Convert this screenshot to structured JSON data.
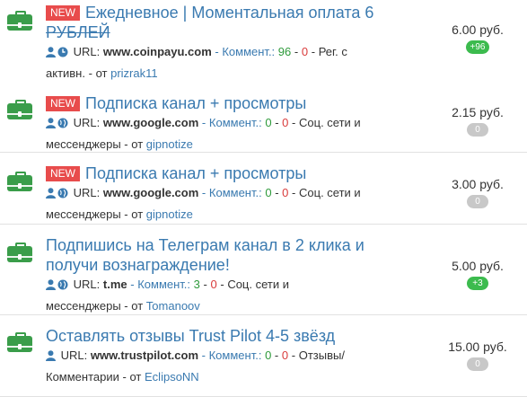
{
  "colors": {
    "accent": "#3a7ab0",
    "badge": "#e84c4c",
    "positive": "#2e9a3b",
    "negative": "#d93b3b",
    "case": "#3a9d4a",
    "pill_green": "#3cbb4e",
    "pill_gray": "#c8c8c8"
  },
  "labels": {
    "url": "URL:",
    "comments": "Коммент.:",
    "dash": "-",
    "from": "от"
  },
  "tasks": [
    {
      "badge": "NEW",
      "title_line1": "Ежедневное | Моментальная оплата 6",
      "title_line2": "РУБЛЕЙ",
      "url": "www.coinpayu.com",
      "comments_pos": "96",
      "comments_neg": "0",
      "category_line1": "Рег. с",
      "category_line2": "активн.",
      "author": "prizrak11",
      "price": "6.00 руб.",
      "rating": "+96",
      "rating_color": "green",
      "icons": [
        "user-icon",
        "clock-icon"
      ]
    },
    {
      "badge": "NEW",
      "title_line1": "Подписка канал + просмотры",
      "url": "www.google.com",
      "comments_pos": "0",
      "comments_neg": "0",
      "category_line1": "Соц. сети и",
      "category_line2": "мессенджеры",
      "author": "gipnotize",
      "price": "2.15 руб.",
      "rating": "0",
      "rating_color": "gray",
      "icons": [
        "user-icon",
        "globe-icon"
      ]
    },
    {
      "badge": "NEW",
      "title_line1": "Подписка канал + просмотры",
      "url": "www.google.com",
      "comments_pos": "0",
      "comments_neg": "0",
      "category_line1": "Соц. сети и",
      "category_line2": "мессенджеры",
      "author": "gipnotize",
      "price": "3.00 руб.",
      "rating": "0",
      "rating_color": "gray",
      "icons": [
        "user-icon",
        "globe-icon"
      ]
    },
    {
      "badge": "",
      "title_line1": "Подпишись на Телеграм канал в 2 клика и",
      "title_line2": "получи вознаграждение!",
      "url": "t.me",
      "comments_pos": "3",
      "comments_neg": "0",
      "category_line1": "Соц. сети и",
      "category_line2": "мессенджеры",
      "author": "Tomanoov",
      "price": "5.00 руб.",
      "rating": "+3",
      "rating_color": "green",
      "icons": [
        "user-icon",
        "globe-icon"
      ]
    },
    {
      "badge": "",
      "title_line1": "Оставлять отзывы Trust Pilot 4-5 звёзд",
      "url": "www.trustpilot.com",
      "comments_pos": "0",
      "comments_neg": "0",
      "category_line1": "Отзывы/",
      "category_line2": "Комментарии",
      "author": "EclipsoNN",
      "price": "15.00 руб.",
      "rating": "0",
      "rating_color": "gray",
      "icons": [
        "user-icon"
      ]
    }
  ]
}
